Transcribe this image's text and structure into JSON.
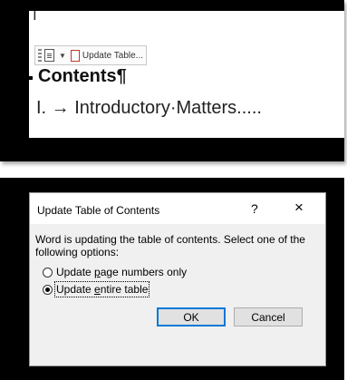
{
  "document": {
    "toolbar": {
      "update_label": "Update Table..."
    },
    "heading": "Contents¶",
    "entry": "I. → Introductory·Matters....."
  },
  "dialog": {
    "title": "Update Table of Contents",
    "help": "?",
    "close": "×",
    "message": "Word is updating the table of contents.  Select one of the following options:",
    "options": [
      {
        "pre": "Update ",
        "access": "p",
        "post": "age numbers only",
        "checked": false
      },
      {
        "pre": "Update ",
        "access": "e",
        "post": "ntire table",
        "checked": true
      }
    ],
    "ok_label": "OK",
    "cancel_label": "Cancel"
  },
  "icons": {
    "toolbar_doc": "document-icon",
    "toolbar_chevron": "chevron-down-icon",
    "toolbar_update": "update-table-icon",
    "close": "close-icon",
    "help": "help-icon"
  }
}
